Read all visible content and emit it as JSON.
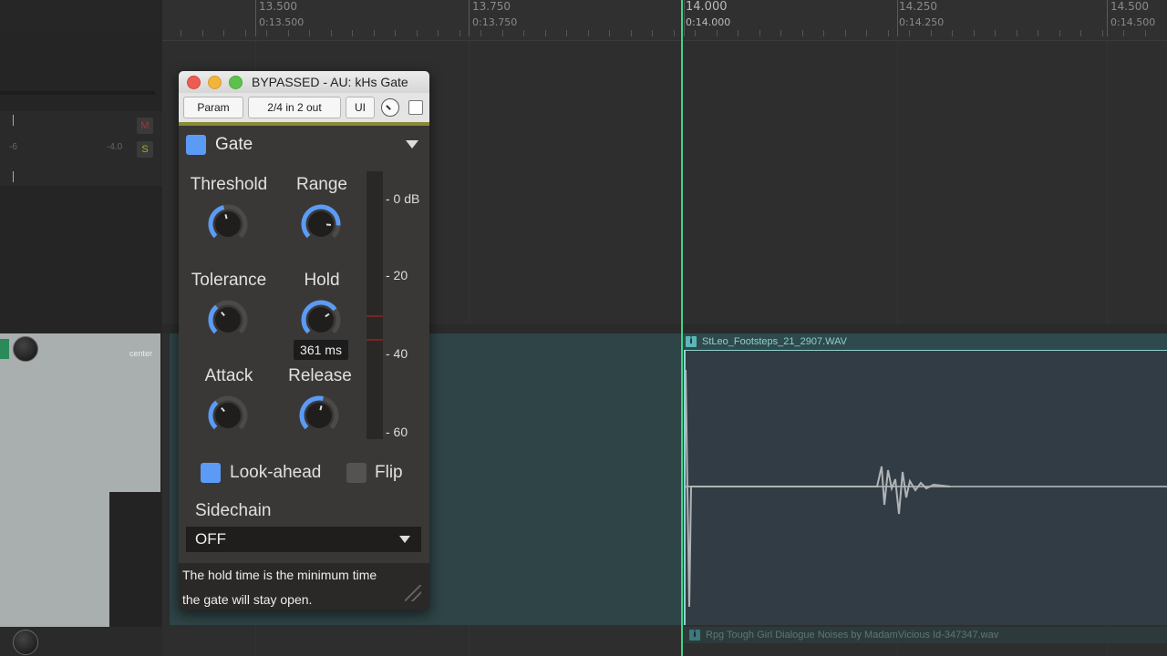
{
  "ruler": {
    "labels": [
      {
        "bar": "13.500",
        "time": "0:13.500"
      },
      {
        "bar": "13.750",
        "time": "0:13.750"
      },
      {
        "bar": "14.000",
        "time": "0:14.000"
      },
      {
        "bar": "14.250",
        "time": "0:14.250"
      },
      {
        "bar": "14.500",
        "time": "0:14.500"
      }
    ]
  },
  "tracks": {
    "track1": {
      "mute_label": "M",
      "solo_label": "S",
      "pan_value": "-6",
      "vol_value": "-4.0"
    },
    "track2": {
      "pan_label": "center"
    }
  },
  "items": {
    "item1": {
      "badge": "i",
      "name": "StLeo_Footsteps_21_2907.WAV"
    },
    "item2": {
      "badge": "i",
      "name": "Rpg  Tough Girl Dialogue Noises by MadamVicious Id-347347.wav"
    }
  },
  "plugin": {
    "title": "BYPASSED - AU: kHs Gate",
    "toolbar": {
      "param_label": "Param",
      "io_label": "2/4 in 2 out",
      "ui_label": "UI"
    },
    "module_name": "Gate",
    "params": {
      "threshold": {
        "label": "Threshold",
        "level": 0.45
      },
      "range": {
        "label": "Range",
        "level": 0.85
      },
      "tolerance": {
        "label": "Tolerance",
        "level": 0.35
      },
      "hold": {
        "label": "Hold",
        "level": 0.7,
        "tooltip": "361 ms"
      },
      "attack": {
        "label": "Attack",
        "level": 0.35
      },
      "release": {
        "label": "Release",
        "level": 0.55
      }
    },
    "meter_labels": [
      "- 0 dB",
      "- 20",
      "- 40",
      "- 60"
    ],
    "checkboxes": {
      "lookahead_label": "Look-ahead",
      "lookahead_checked": true,
      "flip_label": "Flip",
      "flip_checked": false
    },
    "sidechain": {
      "label": "Sidechain",
      "value": "OFF"
    },
    "description": [
      "The hold time is the minimum time",
      "the gate will stay open."
    ]
  },
  "colors": {
    "accent": "#5b9bf5",
    "playhead": "#3fd48a",
    "item_border": "#8fd0cf"
  }
}
